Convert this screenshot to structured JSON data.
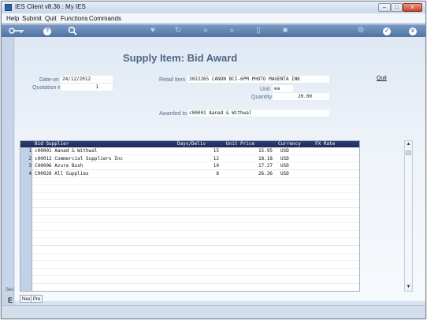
{
  "window": {
    "title": "IES Client v8.36 : My IES",
    "close_label": "x",
    "min_label": "–",
    "max_label": "□"
  },
  "menu": {
    "items": [
      "Help",
      "Submit",
      "Quit",
      "Functions",
      "Commands"
    ]
  },
  "toolbar": {
    "icons": [
      "key-icon",
      "help-icon",
      "search-icon",
      "heart-icon",
      "refresh-icon",
      "rewind-icon",
      "fast-forward-icon",
      "bookmark-icon",
      "stop-icon",
      "settings-icon",
      "check-icon",
      "close-icon"
    ],
    "help_glyph": "?",
    "check_glyph": "✓",
    "close_glyph": "x"
  },
  "page": {
    "title": "Supply Item: Bid Award",
    "quit_label": "Quit"
  },
  "form": {
    "date_on_label": "Date-on",
    "date_on_value": "24/12/2012",
    "quotation_label": "Quotation #",
    "quotation_value": "1",
    "retail_item_label": "Retail Item",
    "retail_item_value": "3022265 CANON BCI-6PM PHOTO MAGENTA INK",
    "unit_label": "Unit",
    "unit_value": "ea",
    "quantity_label": "Quantity",
    "quantity_value": "20.00",
    "awarded_to_label": "Awarded to",
    "awarded_to_value": "c00001 Aanad & Withwal"
  },
  "grid": {
    "columns": [
      "Bid Supplier",
      "Days/Deliv",
      "Unit Price",
      "Currency",
      "FX Rate"
    ],
    "rows": [
      {
        "n": "1",
        "supplier": "c00001 Aanad & Withwal",
        "days": "15",
        "price": "15.95",
        "currency": "USD",
        "fx": ""
      },
      {
        "n": "2",
        "supplier": "c00012 Commercial Suppliers Inc",
        "days": "12",
        "price": "18.18",
        "currency": "USD",
        "fx": ""
      },
      {
        "n": "3",
        "supplier": "C00006 Azure Bush",
        "days": "10",
        "price": "17.27",
        "currency": "USD",
        "fx": ""
      },
      {
        "n": "4",
        "supplier": "C00026 All Supplies",
        "days": "8",
        "price": "26.36",
        "currency": "USD",
        "fx": ""
      }
    ]
  },
  "scroll": {
    "up_glyph": "▲",
    "down_glyph": "▼"
  },
  "tabs": {
    "next": "Nex",
    "prev": "Pre"
  },
  "side": {
    "label": "Ses",
    "glyph": "E"
  }
}
